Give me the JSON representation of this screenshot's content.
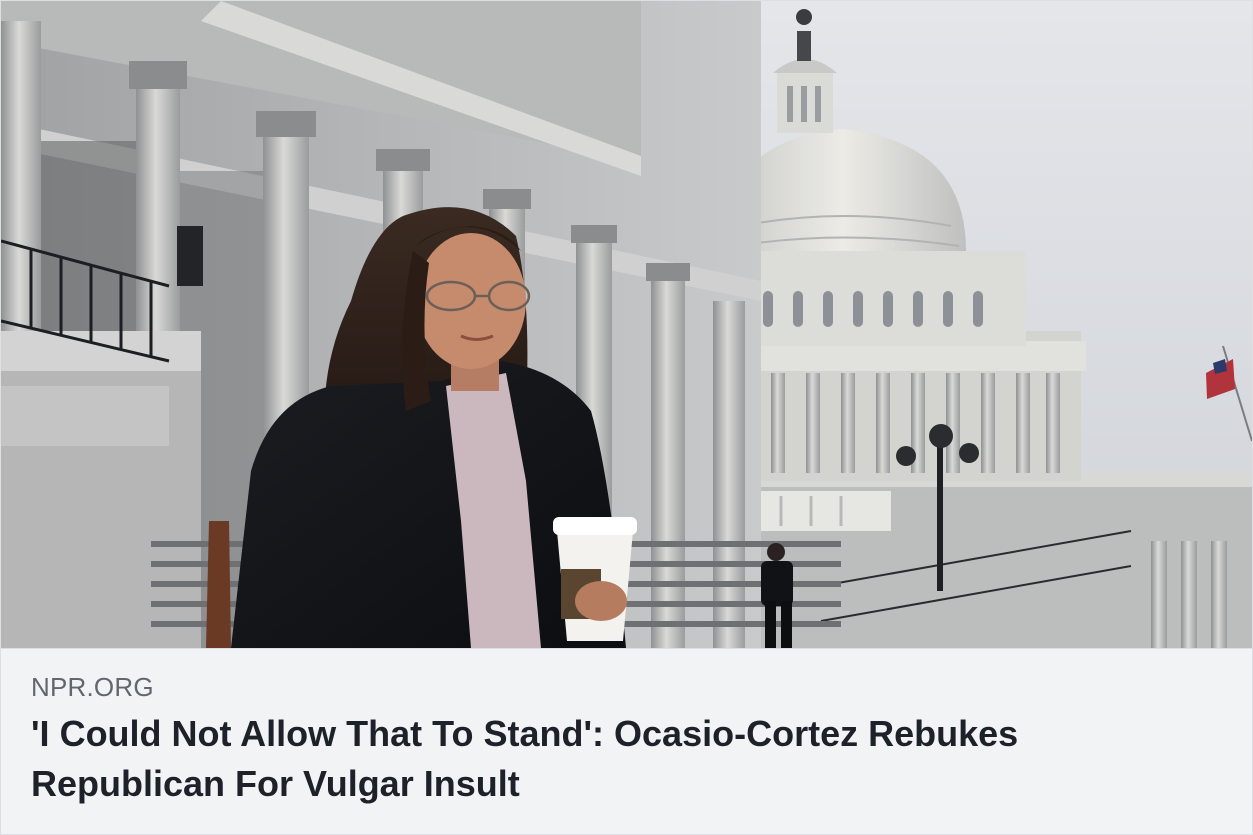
{
  "link_preview": {
    "image_alt": "Ocasio-Cortez walking down the Capitol steps holding a coffee cup",
    "source_domain": "NPR.ORG",
    "headline": "'I Could Not Allow That To Stand': Ocasio-Cortez Rebukes Republican For Vulgar Insult"
  },
  "colors": {
    "card_background": "#f2f3f5",
    "domain_text": "#606770",
    "headline_text": "#1d2129",
    "border": "#dddfe2"
  }
}
